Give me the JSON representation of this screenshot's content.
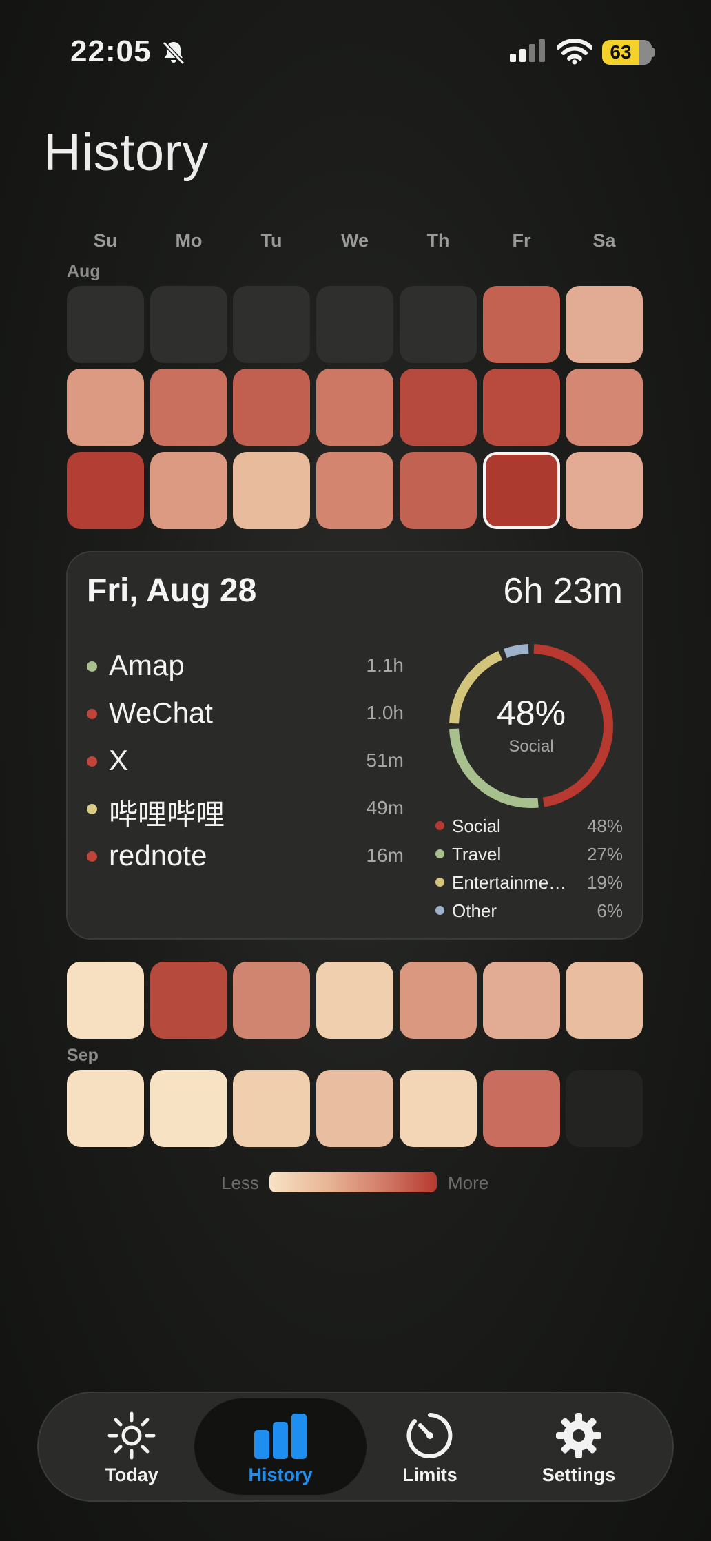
{
  "status_bar": {
    "time": "22:05",
    "battery": "63"
  },
  "page": {
    "title": "History"
  },
  "calendar": {
    "weekdays": [
      "Su",
      "Mo",
      "Tu",
      "We",
      "Th",
      "Fr",
      "Sa"
    ],
    "months": {
      "aug": "Aug",
      "sep": "Sep"
    },
    "colors": {
      "empty": "#2f302e",
      "level1": "#f8e2c4",
      "level2": "#f0cdb0",
      "level3": "#e5b39a",
      "level4": "#dc9a82",
      "level5": "#d08572",
      "level6": "#c6665a",
      "level7": "#bc5046",
      "level8": "#b23e34"
    }
  },
  "detail": {
    "date": "Fri, Aug 28",
    "total": "6h 23m",
    "apps": [
      {
        "name": "Amap",
        "time": "1.1h",
        "color": "#a8bf8e"
      },
      {
        "name": "WeChat",
        "time": "1.0h",
        "color": "#c0443a"
      },
      {
        "name": "X",
        "time": "51m",
        "color": "#c0443a"
      },
      {
        "name": "哔哩哔哩",
        "time": "49m",
        "color": "#d8cc86"
      },
      {
        "name": "rednote",
        "time": "16m",
        "color": "#c0443a"
      }
    ],
    "donut": {
      "center_value": "48%",
      "center_label": "Social",
      "segments": [
        {
          "name": "Social",
          "pct_label": "48%",
          "fraction": 0.48,
          "color": "#b7392f"
        },
        {
          "name": "Travel",
          "pct_label": "27%",
          "fraction": 0.27,
          "color": "#a8bf8e"
        },
        {
          "name": "Entertainme…",
          "pct_label": "19%",
          "fraction": 0.19,
          "color": "#d3c47c"
        },
        {
          "name": "Other",
          "pct_label": "6%",
          "fraction": 0.06,
          "color": "#9fb2cc"
        }
      ]
    }
  },
  "scale": {
    "less": "Less",
    "more": "More"
  },
  "tabs": [
    {
      "label": "Today",
      "icon": "sun-icon",
      "active": false
    },
    {
      "label": "History",
      "icon": "bar-chart-icon",
      "active": true
    },
    {
      "label": "Limits",
      "icon": "timer-icon",
      "active": false
    },
    {
      "label": "Settings",
      "icon": "gear-icon",
      "active": false
    }
  ],
  "colors": {
    "accent": "#1e8ff0",
    "inactive_tab": "#f2f2f2"
  }
}
